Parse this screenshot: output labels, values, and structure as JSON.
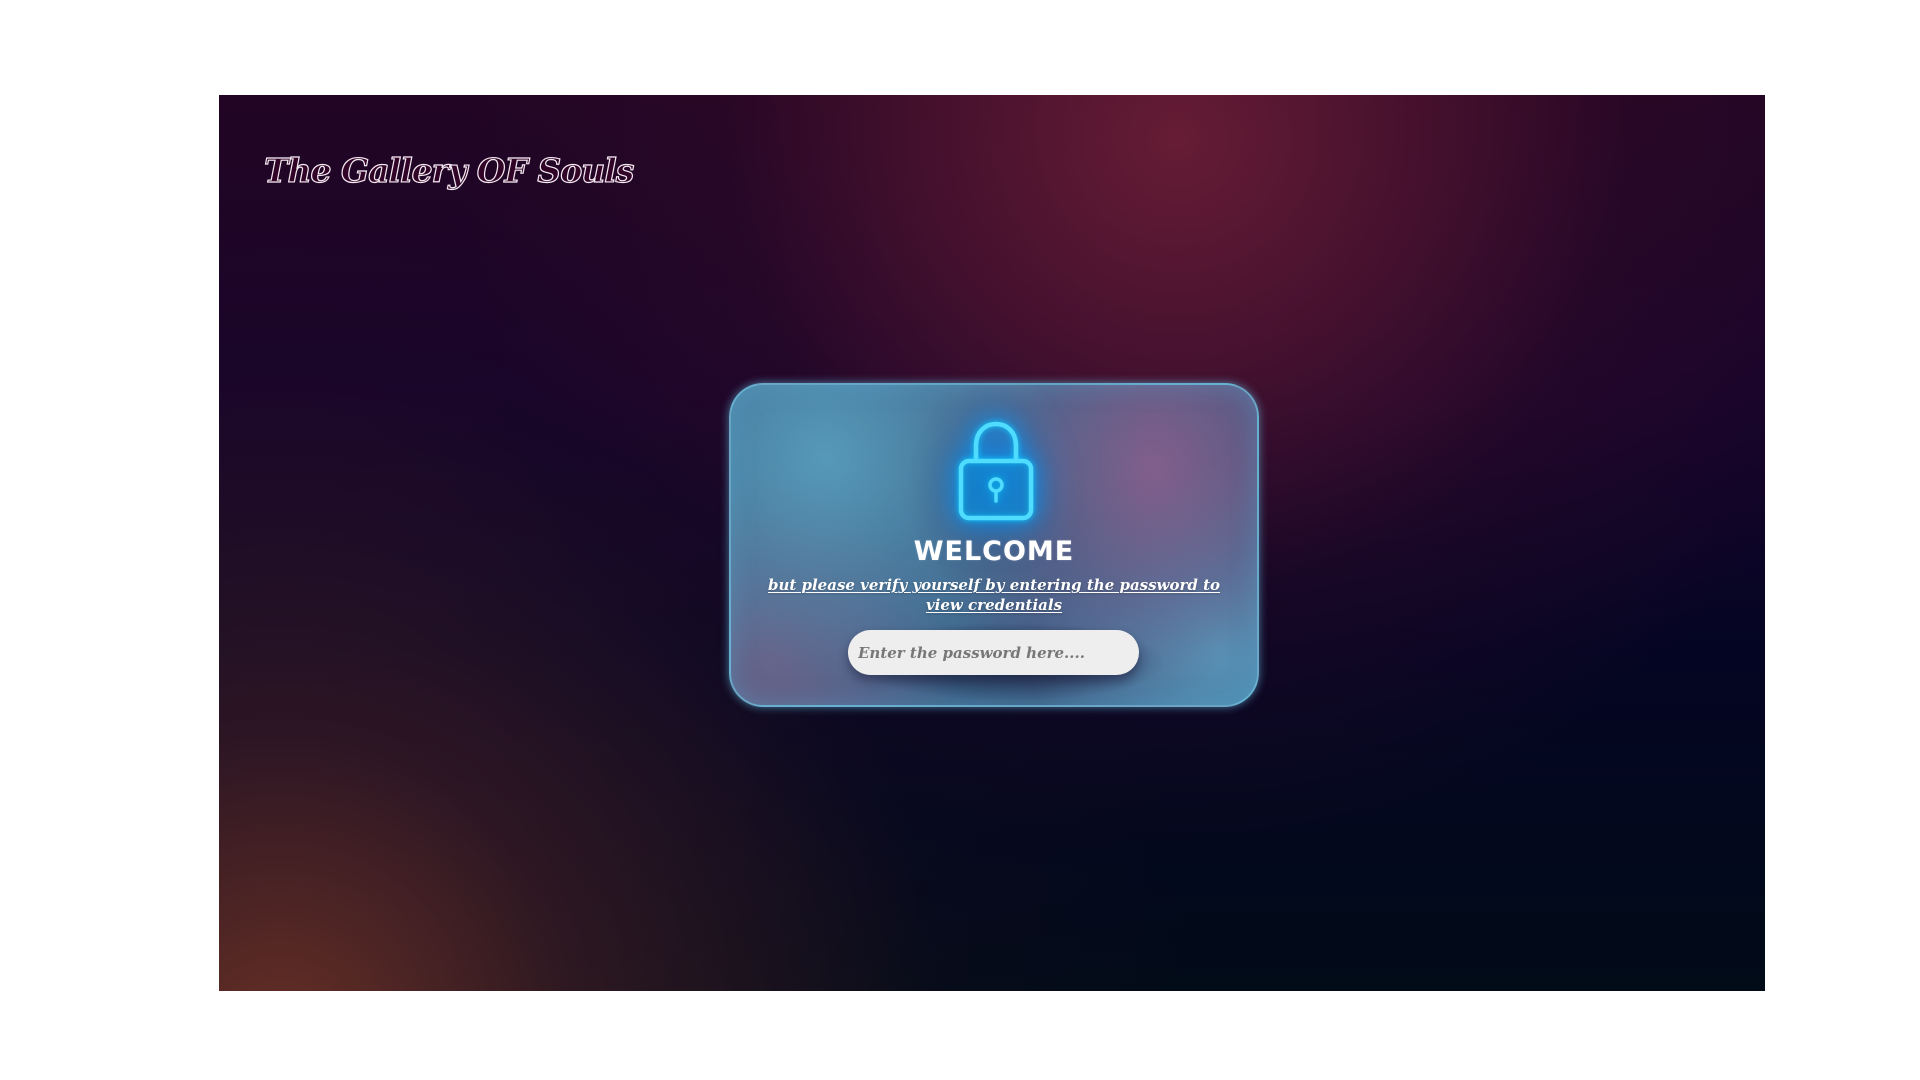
{
  "page": {
    "brand_title": "The Gallery OF Souls"
  },
  "lock_card": {
    "icon": "lock-icon",
    "heading": "WELCOME",
    "subtitle": "but please verify yourself by entering the password to view credentials",
    "password": {
      "value": "",
      "placeholder": "Enter the password here...."
    }
  },
  "colors": {
    "neon_lock": "#00a8ff",
    "input_background": "#eeeeee",
    "card_glass": "#4b7ea3"
  }
}
